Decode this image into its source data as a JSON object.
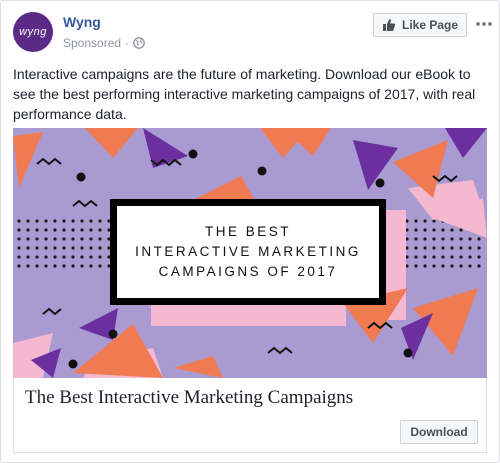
{
  "header": {
    "page_name": "Wyng",
    "avatar_text": "wyng",
    "sponsored_label": "Sponsored",
    "separator": "·",
    "privacy_icon": "globe-icon",
    "like_page_label": "Like Page",
    "like_icon": "thumbs-up-icon",
    "more_icon": "ellipsis-icon"
  },
  "post": {
    "body_text": "Interactive campaigns are the future of marketing. Download our eBook to see the best performing interactive marketing campaigns of 2017, with real performance data."
  },
  "creative": {
    "headline_line1": "THE BEST",
    "headline_line2": "INTERACTIVE MARKETING",
    "headline_line3": "CAMPAIGNS OF 2017",
    "background_color": "#a99bd1",
    "accent_colors": [
      "#f07a52",
      "#6b2fa0",
      "#f4b8d0",
      "#000000"
    ]
  },
  "link": {
    "title": "The Best Interactive Marketing Campaigns",
    "cta_label": "Download"
  },
  "colors": {
    "brand_link": "#365899",
    "avatar_bg": "#5b2a86",
    "meta_text": "#90949c"
  }
}
